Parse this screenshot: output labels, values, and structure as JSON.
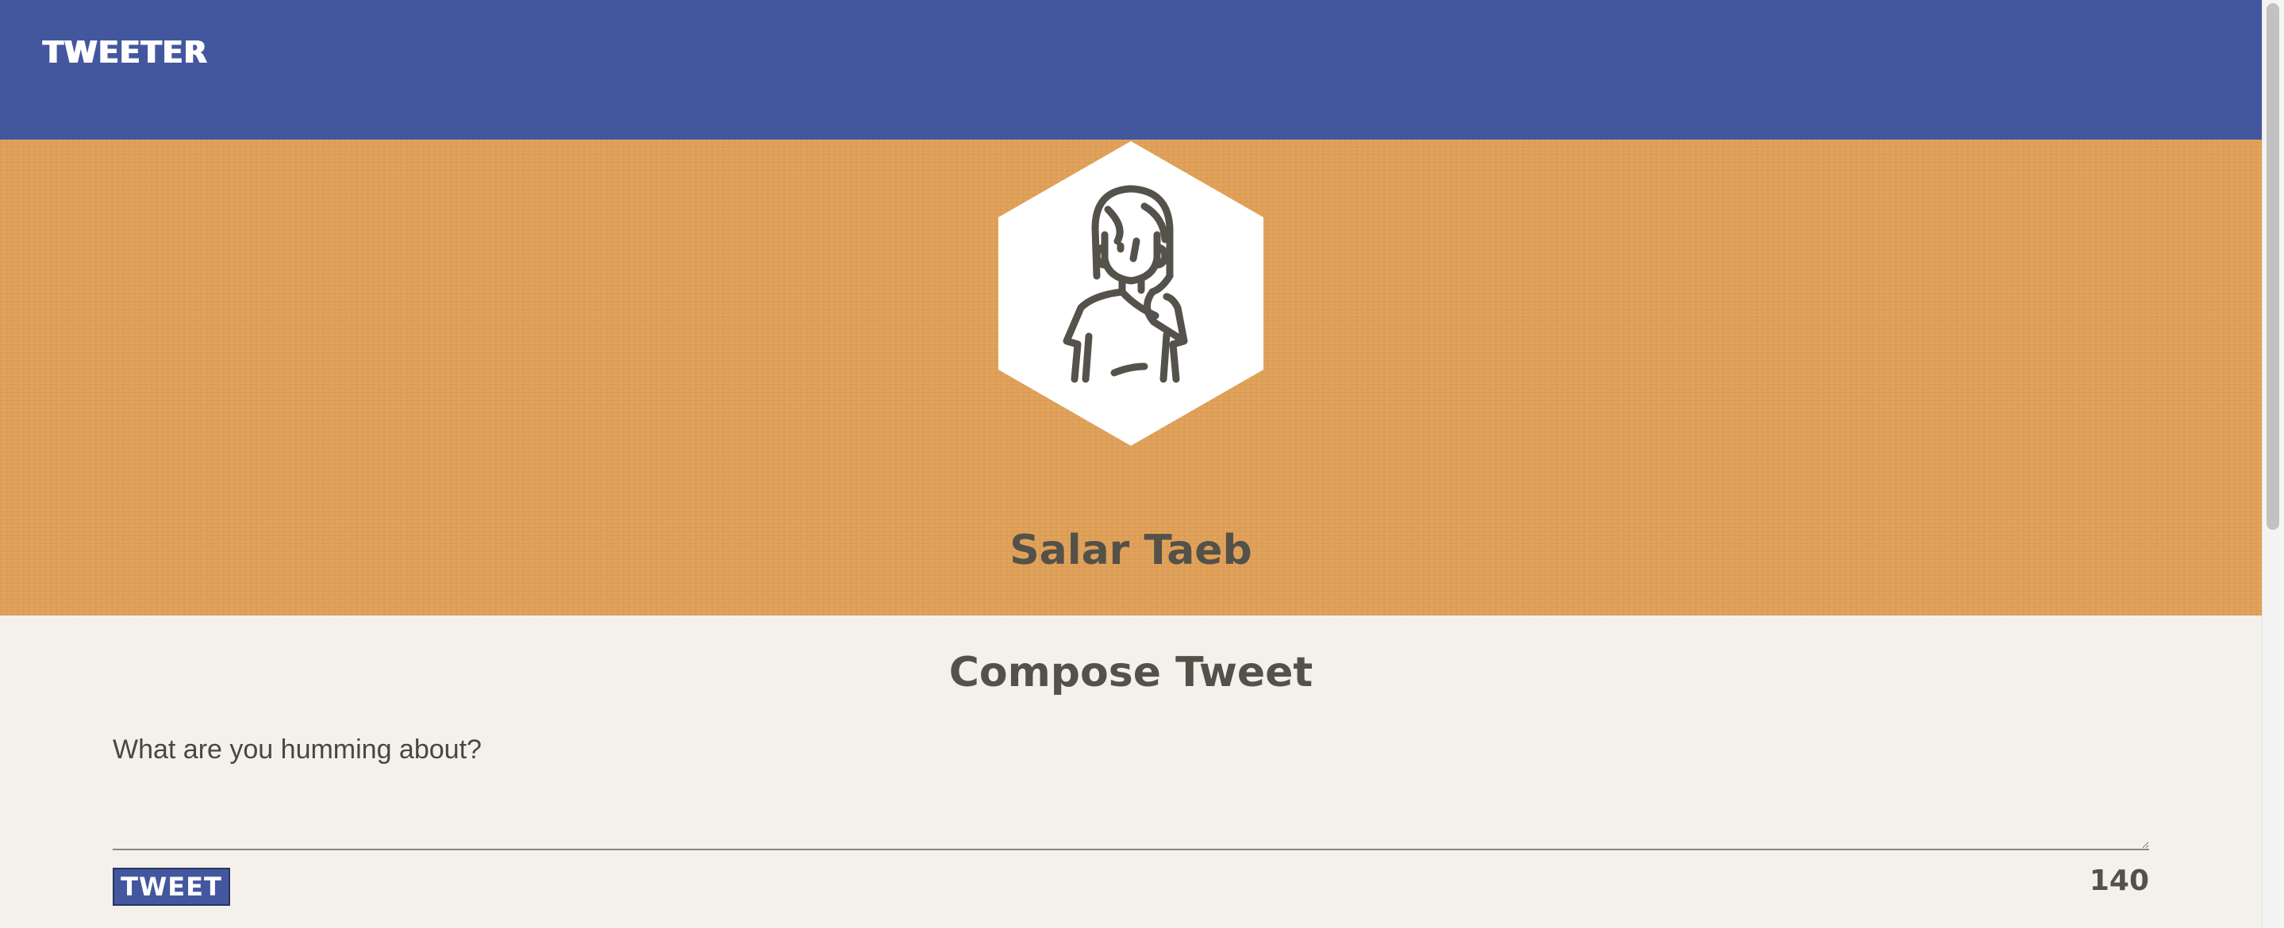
{
  "nav": {
    "brand": "TWEETER",
    "background_color": "#43579f"
  },
  "profile": {
    "name": "Salar Taeb",
    "avatar_icon": "person-avatar-icon",
    "background_color": "#e1a157"
  },
  "compose": {
    "title": "Compose Tweet",
    "placeholder": "What are you humming about?",
    "value": "",
    "button_label": "TWEET",
    "char_count": "140",
    "accent_color": "#43579f"
  }
}
